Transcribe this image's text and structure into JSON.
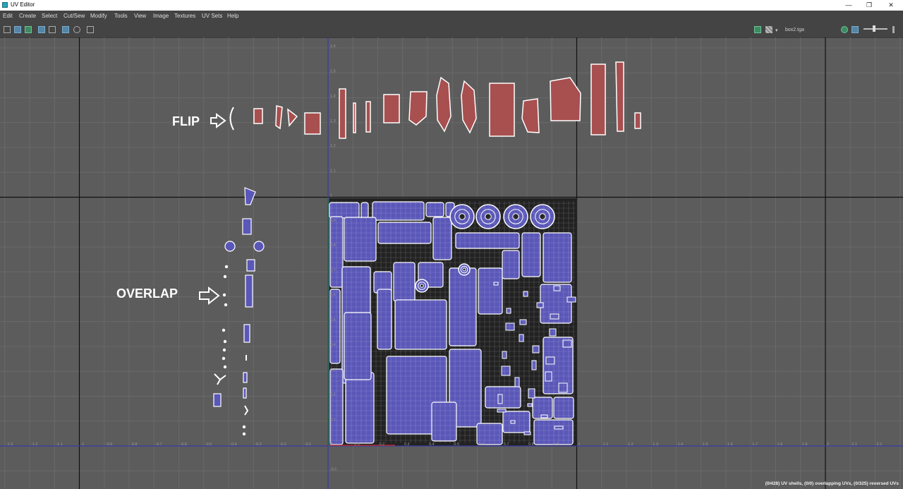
{
  "window": {
    "title": "UV Editor",
    "minimize": "—",
    "restore": "❐",
    "close": "✕"
  },
  "menu": [
    "Edit",
    "Create",
    "Select",
    "Cut/Sew",
    "Modify",
    "Tools",
    "View",
    "Image",
    "Textures",
    "UV Sets",
    "Help"
  ],
  "toolbar": {
    "left_icons": [
      "uv-shell-icon",
      "uv-select-icon",
      "shaded-icon",
      "grid-icon",
      "wireframe-icon",
      "checker-display-icon",
      "isolate-icon",
      "snapshot-icon"
    ],
    "image_name": "box2.tga"
  },
  "annotations": {
    "flip": "FLIP",
    "overlap": "OVERLAP"
  },
  "status": "(0/428) UV shells, (0/0) overlapping UVs, (0/325) reversed UVs",
  "colors": {
    "background": "#5c5c5c",
    "grid_minor": "#696969",
    "grid_major": "#111111",
    "axis_v": "#3a3aa8",
    "axis_u": "#3a3aa8",
    "flipped_shell_fill": "#a84f4f",
    "normal_shell_fill": "#5a57b8",
    "uv_outline": "#ffffff"
  }
}
